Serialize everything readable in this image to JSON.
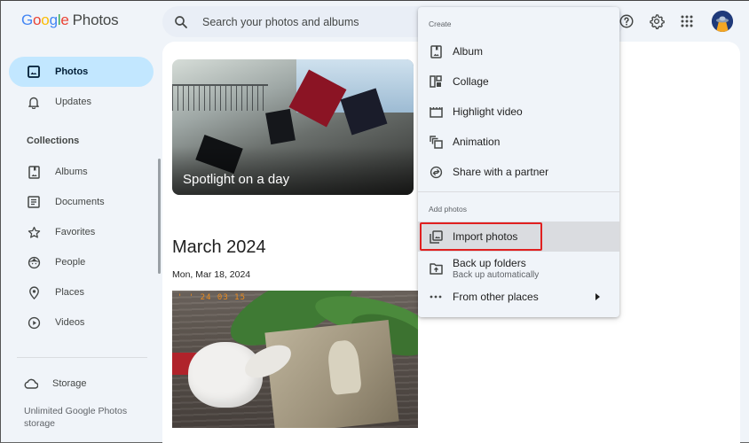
{
  "app": {
    "brand_letters": [
      "G",
      "o",
      "o",
      "g",
      "l",
      "e"
    ],
    "product": "Photos"
  },
  "search": {
    "placeholder": "Search your photos and albums",
    "icon": "search-icon"
  },
  "header_actions": [
    {
      "name": "help",
      "icon": "help-icon"
    },
    {
      "name": "settings",
      "icon": "gear-icon"
    },
    {
      "name": "apps",
      "icon": "apps-grid-icon"
    },
    {
      "name": "account",
      "icon": "avatar"
    }
  ],
  "sidebar": {
    "items": [
      {
        "label": "Photos",
        "icon": "photo-icon",
        "active": true
      },
      {
        "label": "Updates",
        "icon": "bell-icon",
        "active": false
      }
    ],
    "collections_label": "Collections",
    "collections": [
      {
        "label": "Albums",
        "icon": "album-icon"
      },
      {
        "label": "Documents",
        "icon": "document-icon"
      },
      {
        "label": "Favorites",
        "icon": "star-icon"
      },
      {
        "label": "People",
        "icon": "face-icon"
      },
      {
        "label": "Places",
        "icon": "location-pin-icon"
      },
      {
        "label": "Videos",
        "icon": "play-circle-icon"
      }
    ],
    "storage": {
      "label": "Storage",
      "icon": "cloud-icon",
      "note": "Unlimited Google Photos storage"
    }
  },
  "main": {
    "spotlight": {
      "title": "Spotlight on a day"
    },
    "month_title": "March 2024",
    "date_label": "Mon, Mar 18, 2024",
    "photo_stamp": "' '  24  03  15"
  },
  "create_menu": {
    "create_label": "Create",
    "create_items": [
      {
        "label": "Album",
        "icon": "album-icon"
      },
      {
        "label": "Collage",
        "icon": "collage-icon"
      },
      {
        "label": "Highlight video",
        "icon": "movie-icon"
      },
      {
        "label": "Animation",
        "icon": "animation-icon"
      },
      {
        "label": "Share with a partner",
        "icon": "partner-share-icon"
      }
    ],
    "add_label": "Add photos",
    "add_items": [
      {
        "label": "Import photos",
        "icon": "import-photos-icon",
        "highlighted": true
      },
      {
        "label": "Back up folders",
        "sublabel": "Back up automatically",
        "icon": "folder-upload-icon"
      },
      {
        "label": "From other places",
        "icon": "more-horiz-icon",
        "has_submenu": true
      }
    ]
  },
  "colors": {
    "active_nav_bg": "#c2e7ff",
    "highlight_border": "#e02020",
    "page_bg": "#f0f4f9"
  }
}
